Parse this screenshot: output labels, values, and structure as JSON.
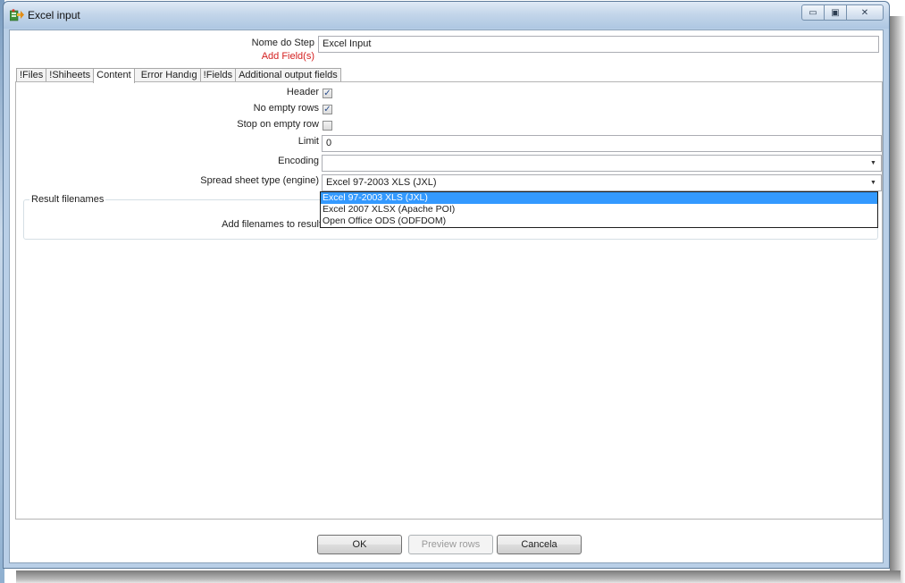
{
  "window": {
    "title": "Excel input",
    "minimize": "▭",
    "maximize": "▣",
    "close": "✕"
  },
  "header": {
    "step_name_label": "Nome do Step",
    "step_name_value": "Excel Input",
    "add_fields_link": "Add Field(s)"
  },
  "tabs": [
    {
      "label": "!Files"
    },
    {
      "label": "!Shiheets"
    },
    {
      "label": "Content"
    },
    {
      "label": "Error Handıg"
    },
    {
      "label": "!Fields"
    },
    {
      "label": "Additional output fields"
    }
  ],
  "content": {
    "header_label": "Header",
    "header_checked": "✓",
    "no_empty_rows_label": "No empty rows",
    "no_empty_rows_checked": "✓",
    "stop_on_empty_row_label": "Stop on empty row",
    "stop_on_empty_row_checked": "",
    "limit_label": "Limit",
    "limit_value": "0",
    "encoding_label": "Encoding",
    "encoding_value": "",
    "spreadsheet_type_label": "Spread sheet type (engine)",
    "spreadsheet_type_value": "Excel 97-2003 XLS (JXL)",
    "spreadsheet_options": [
      "Excel 97-2003 XLS (JXL)",
      "Excel 2007 XLSX (Apache POI)",
      "Open Office ODS (ODFDOM)"
    ]
  },
  "result_filenames": {
    "group_title": "Result filenames",
    "add_filenames_label": "Add filenames to result"
  },
  "footer": {
    "ok": "OK",
    "preview_rows": "Preview rows",
    "cancel": "Cancela"
  },
  "colors": {
    "selected_option": "#3399ff",
    "add_fields_link": "#d42020",
    "title_bar": "#c4d6ea"
  }
}
